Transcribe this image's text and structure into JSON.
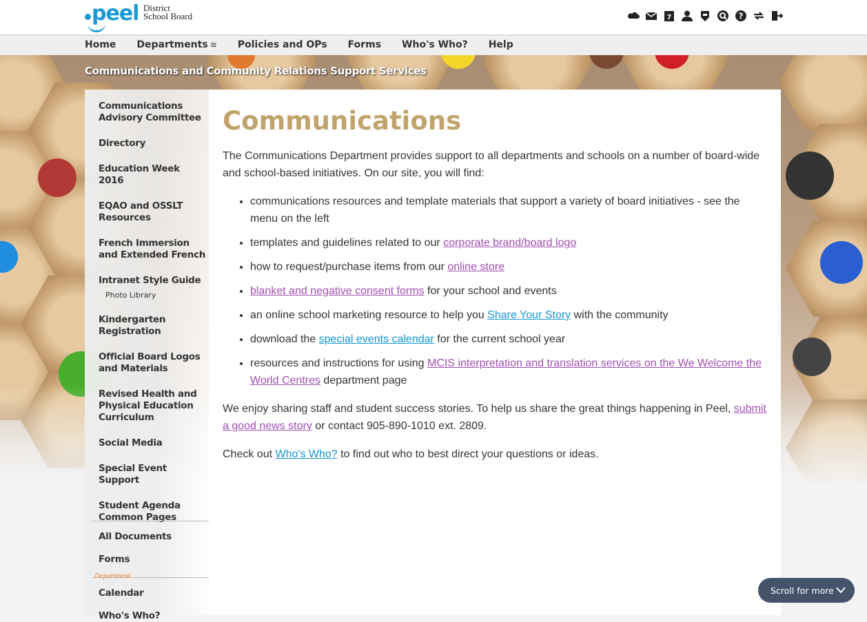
{
  "logo": {
    "word": "peel",
    "board_line1": "District",
    "board_line2": "School Board"
  },
  "toolbar": {
    "icons": [
      "cloud-icon",
      "mail-icon",
      "calendar-icon",
      "person-icon",
      "shield-icon",
      "search-icon",
      "help-icon",
      "switch-icon",
      "logout-icon"
    ],
    "calendar_label": "7"
  },
  "nav": {
    "items": [
      "Home",
      "Departments",
      "Policies and OPs",
      "Forms",
      "Who's Who?",
      "Help"
    ],
    "departments_menu_glyph": "≡"
  },
  "section_title": "Communications and Community Relations Support Services",
  "sidebar": {
    "items": [
      "Communications Advisory Committee",
      "Directory",
      "Education Week 2016",
      "EQAO and OSSLT Resources",
      "French Immersion and Extended French",
      "Intranet Style Guide",
      "Kindergarten Registration",
      "Official Board Logos and Materials",
      "Revised Health and Physical Education Curriculum",
      "Social Media",
      "Special Event Support",
      "Student Agenda Common Pages"
    ],
    "sub_item": "Photo Library",
    "secondary": [
      "All Documents",
      "Forms"
    ],
    "department_tag": "Department",
    "tertiary": [
      "Calendar",
      "Who's Who?"
    ]
  },
  "main": {
    "title": "Communications",
    "intro": "The Communications Department provides support to all departments and schools on a number of board-wide and school-based initiatives. On our site, you will find:",
    "bullets": {
      "b1": "communications resources and template materials that support a variety of board initiatives - see the menu on the left",
      "b2_pre": "templates and guidelines related to our ",
      "b2_link": "corporate brand/board logo",
      "b3_pre": "how to request/purchase items from our ",
      "b3_link": "online store",
      "b4_link": "blanket and negative consent forms",
      "b4_post": " for your school and events",
      "b5_pre": "an online school marketing resource to help you ",
      "b5_link": "Share Your Story",
      "b5_post": " with the community",
      "b6_pre": "download the ",
      "b6_link": "special events calendar",
      "b6_post": " for the current school year",
      "b7_pre": "resources and instructions for using ",
      "b7_link": "MCIS interpretation and translation services on the We Welcome the World Centres",
      "b7_post": " department page"
    },
    "para2_pre": "We enjoy sharing staff and student success stories. To help us share the great things happening in Peel, ",
    "para2_link": "submit a good news story",
    "para2_post": " or contact 905-890-1010 ext. 2809.",
    "para3_pre": "Check out ",
    "para3_link": "Who's Who?",
    "para3_post": " to find out who to best direct your questions or ideas."
  },
  "scroll_prompt": "Scroll for more",
  "colors": {
    "brand_blue": "#1a9ad6",
    "title_gold": "#c1a46d",
    "visited_link": "#a04fb2",
    "link": "#1596d3",
    "scroll_pill": "#44526a"
  }
}
